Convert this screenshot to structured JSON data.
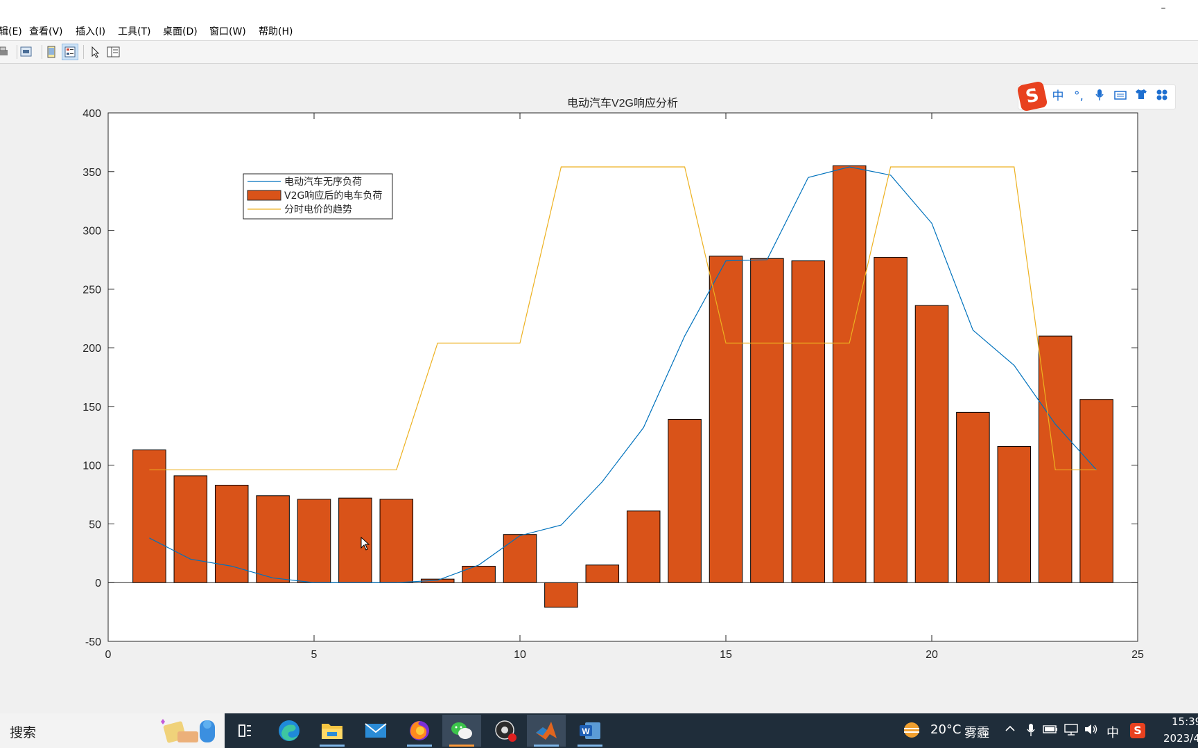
{
  "window": {
    "minimize_glyph": "–"
  },
  "menu": {
    "items": [
      "辑(E)",
      "查看(V)",
      "插入(I)",
      "工具(T)",
      "桌面(D)",
      "窗口(W)",
      "帮助(H)"
    ]
  },
  "toolbar": {
    "icons": [
      "print-icon",
      "print-preview-icon",
      "dock-figure-icon",
      "property-editor-icon",
      "pointer-icon",
      "plot-browser-icon"
    ]
  },
  "ime": {
    "logo": "S",
    "lang": "中",
    "punct": "°,",
    "icons": [
      "microphone-icon",
      "keyboard-icon",
      "skin-icon",
      "toolbox-icon"
    ]
  },
  "chart_data": {
    "type": "bar",
    "title": "电动汽车V2G响应分析",
    "xlim": [
      0,
      25
    ],
    "ylim": [
      -50,
      400
    ],
    "xticks": [
      0,
      5,
      10,
      15,
      20,
      25
    ],
    "yticks": [
      -50,
      0,
      50,
      100,
      150,
      200,
      250,
      300,
      350,
      400
    ],
    "grid": false,
    "legend_position": "top-left",
    "x": [
      1,
      2,
      3,
      4,
      5,
      6,
      7,
      8,
      9,
      10,
      11,
      12,
      13,
      14,
      15,
      16,
      17,
      18,
      19,
      20,
      21,
      22,
      23,
      24
    ],
    "series": [
      {
        "name": "电动汽车无序负荷",
        "kind": "line",
        "color": "#0072bd",
        "values": [
          38,
          20,
          14,
          4,
          0,
          0,
          0,
          2,
          15,
          40,
          49,
          86,
          132,
          210,
          274,
          275,
          345,
          354,
          347,
          306,
          215,
          185,
          135,
          96
        ]
      },
      {
        "name": "V2G响应后的电车负荷",
        "kind": "bar",
        "color": "#d95319",
        "values": [
          113,
          91,
          83,
          74,
          71,
          72,
          71,
          3,
          14,
          41,
          -21,
          15,
          61,
          139,
          278,
          276,
          274,
          355,
          277,
          236,
          145,
          116,
          210,
          156
        ]
      },
      {
        "name": "分时电价的趋势",
        "kind": "line",
        "color": "#edb120",
        "values": [
          96,
          96,
          96,
          96,
          96,
          96,
          96,
          204,
          204,
          204,
          354,
          354,
          354,
          354,
          204,
          204,
          204,
          204,
          354,
          354,
          354,
          354,
          96,
          96
        ]
      }
    ]
  },
  "taskbar": {
    "search_label": "搜索",
    "apps": [
      "task-view-icon",
      "edge-icon",
      "file-explorer-icon",
      "mail-icon",
      "firefox-icon",
      "wechat-icon",
      "obs-icon",
      "matlab-icon",
      "word-icon"
    ],
    "weather": {
      "temp": "20°C",
      "condition": "雾霾"
    },
    "tray_ime": "中",
    "time": "15:39",
    "date": "2023/4"
  }
}
